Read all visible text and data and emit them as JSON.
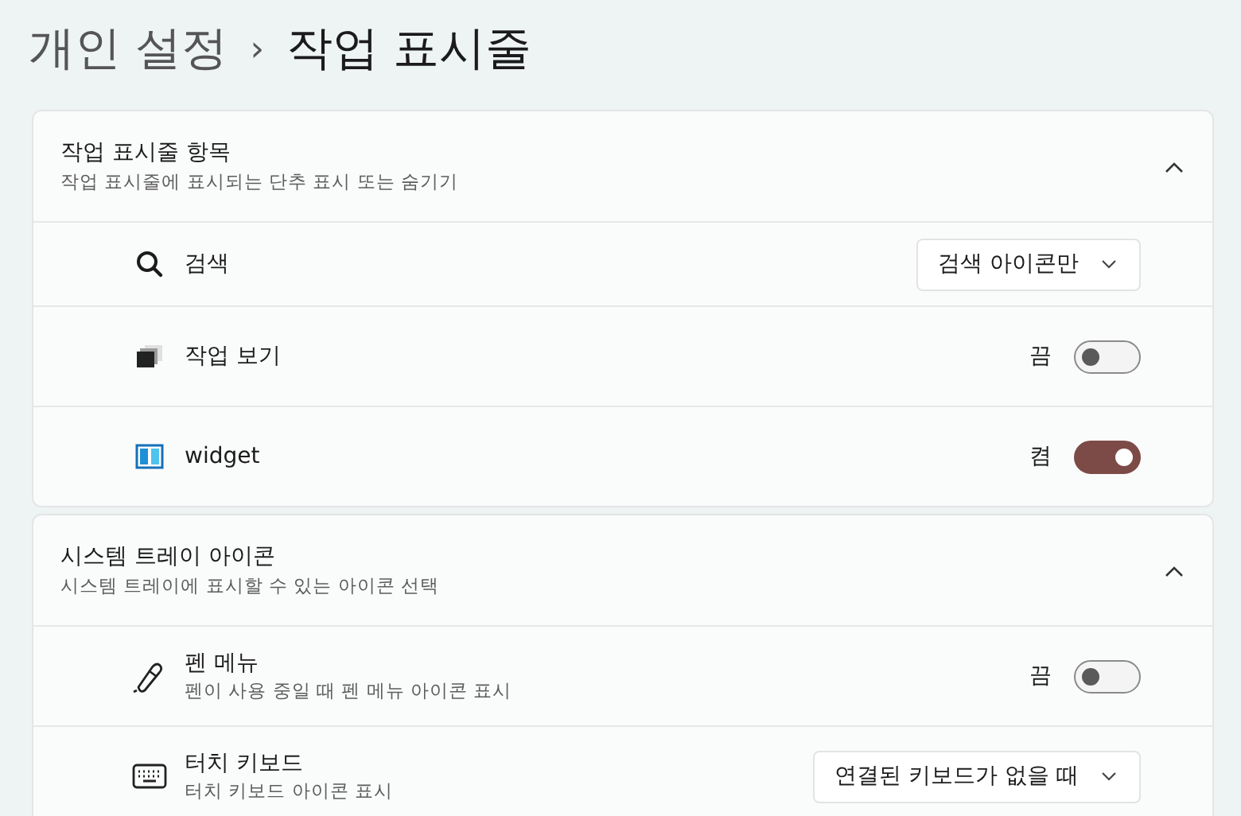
{
  "breadcrumb": {
    "parent": "개인 설정",
    "separator": "›",
    "current": "작업 표시줄"
  },
  "sections": [
    {
      "title": "작업 표시줄 항목",
      "subtitle": "작업 표시줄에 표시되는 단추 표시 또는 숨기기",
      "expanded": true,
      "items": [
        {
          "kind": "dropdown",
          "label": "검색",
          "value": "검색 아이콘만"
        },
        {
          "kind": "toggle",
          "label": "작업 보기",
          "state_text": "끔",
          "on": false
        },
        {
          "kind": "toggle",
          "label": "widget",
          "state_text": "켬",
          "on": true
        }
      ]
    },
    {
      "title": "시스템 트레이 아이콘",
      "subtitle": "시스템 트레이에 표시할 수 있는 아이콘 선택",
      "expanded": true,
      "items": [
        {
          "kind": "toggle",
          "label": "펜 메뉴",
          "description": "펜이 사용 중일 때 펜 메뉴 아이콘 표시",
          "state_text": "끔",
          "on": false
        },
        {
          "kind": "dropdown",
          "label": "터치 키보드",
          "description": "터치 키보드 아이콘 표시",
          "value": "연결된 키보드가 없을 때"
        }
      ]
    }
  ]
}
